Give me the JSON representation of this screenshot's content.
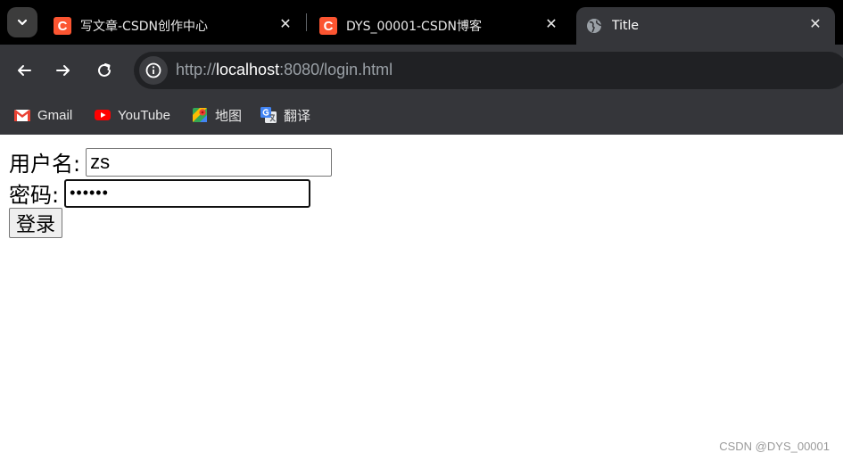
{
  "browser": {
    "tabs": [
      {
        "title": "写文章-CSDN创作中心",
        "favicon": "csdn-icon",
        "favicon_text": "C",
        "active": false
      },
      {
        "title": "DYS_00001-CSDN博客",
        "favicon": "csdn-icon",
        "favicon_text": "C",
        "active": false
      },
      {
        "title": "Title",
        "favicon": "globe-icon",
        "active": true
      }
    ],
    "url_scheme": "http://",
    "url_host": "localhost",
    "url_rest": ":8080/login.html",
    "bookmarks": [
      {
        "label": "Gmail",
        "icon": "gmail-icon"
      },
      {
        "label": "YouTube",
        "icon": "youtube-icon"
      },
      {
        "label": "地图",
        "icon": "maps-icon"
      },
      {
        "label": "翻译",
        "icon": "translate-icon"
      }
    ],
    "colors": {
      "tabstrip": "#000000",
      "toolbar": "#35363a",
      "omnibox": "#202124",
      "csdn": "#fc5531"
    }
  },
  "page": {
    "username_label": "用户名:",
    "username_value": "zs",
    "password_label": "密码:",
    "password_masked": "••••••",
    "login_label": "登录",
    "watermark": "CSDN @DYS_00001"
  }
}
